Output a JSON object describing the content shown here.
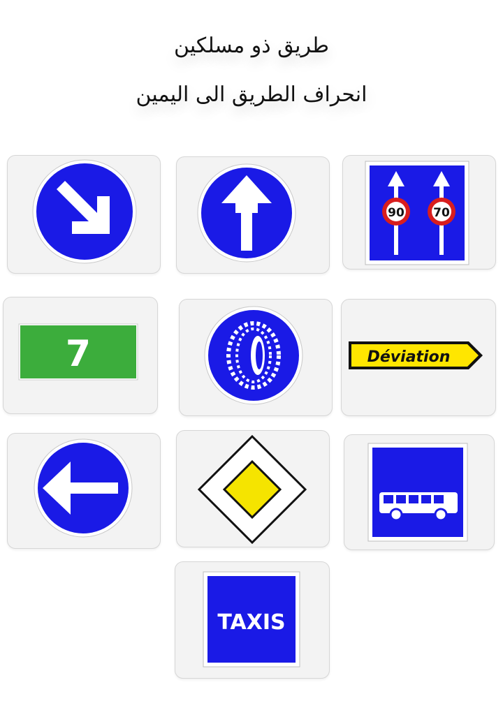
{
  "question": {
    "line1": "طريق ذو مسلكين",
    "line2": "انحراف الطريق الى اليمين"
  },
  "signs": [
    {
      "icon": "keep-right-arrow-icon"
    },
    {
      "icon": "ahead-only-arrow-icon"
    },
    {
      "icon": "lane-speed-limits-icon",
      "speed_left": "90",
      "speed_right": "70"
    },
    {
      "icon": "route-number-icon",
      "number": "7"
    },
    {
      "icon": "snow-chains-required-icon"
    },
    {
      "icon": "deviation-arrow-icon",
      "text": "Déviation"
    },
    {
      "icon": "keep-left-arrow-icon"
    },
    {
      "icon": "priority-road-diamond-icon"
    },
    {
      "icon": "bus-lane-icon"
    },
    {
      "icon": "taxis-sign-icon",
      "text": "TAXIS"
    }
  ],
  "colors": {
    "sign_blue": "#1a1ae6",
    "route_green": "#3cad3c",
    "deviation_yellow": "#ffe600",
    "priority_yellow": "#f5e400",
    "speed_red": "#d81e1e",
    "card_bg": "#f3f3f3"
  }
}
